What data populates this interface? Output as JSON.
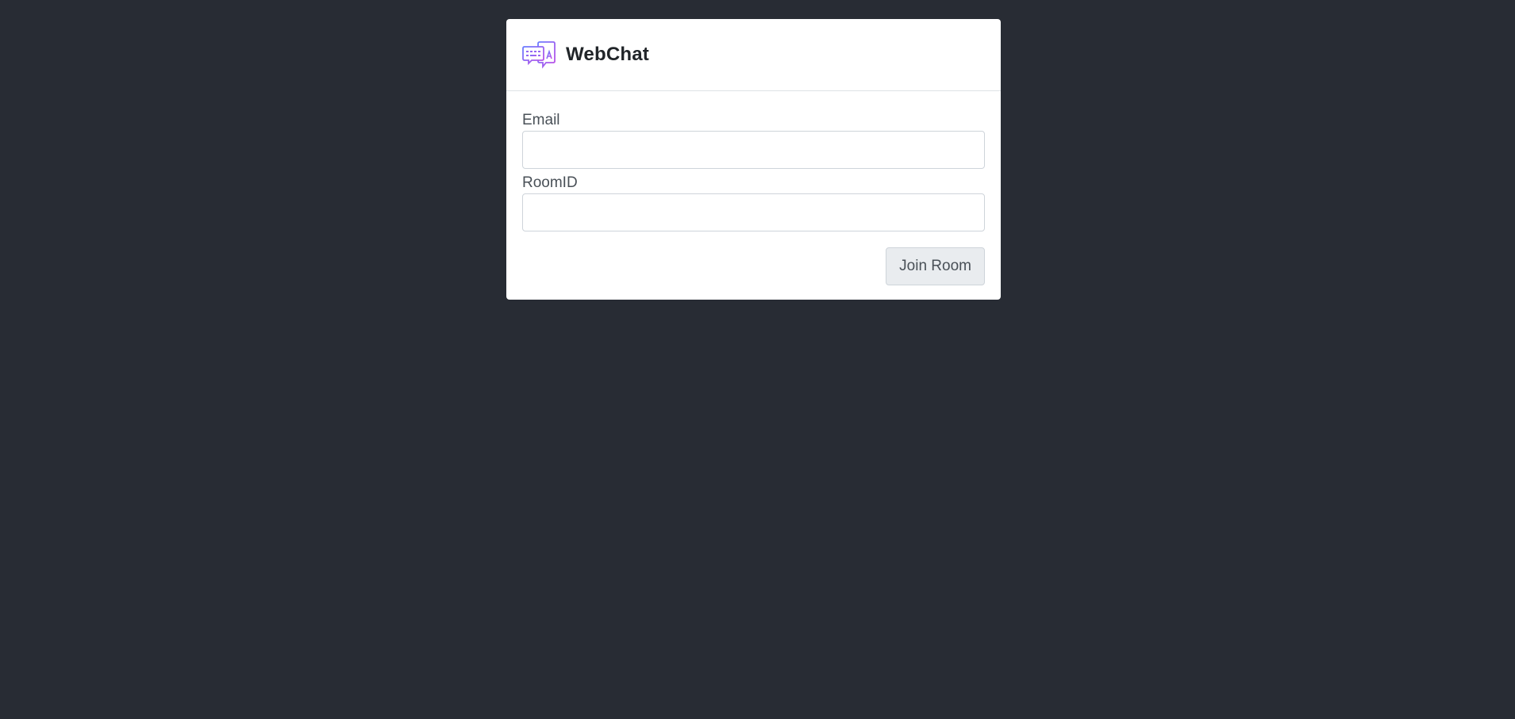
{
  "app": {
    "title": "WebChat",
    "logo_icon": "chat-bubbles-icon",
    "colors": {
      "background": "#282c34",
      "card": "#ffffff",
      "logo_gradient_start": "#6a7cff",
      "logo_gradient_end": "#c04fe6"
    }
  },
  "form": {
    "email_label": "Email",
    "email_value": "",
    "room_label": "RoomID",
    "room_value": "",
    "join_button_label": "Join Room"
  }
}
